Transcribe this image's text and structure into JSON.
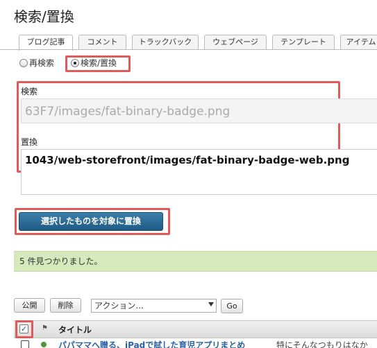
{
  "page": {
    "title": "検索/置換"
  },
  "tabs": [
    {
      "label": "ブログ記事",
      "active": true
    },
    {
      "label": "コメント",
      "active": false
    },
    {
      "label": "トラックバック",
      "active": false
    },
    {
      "label": "ウェブページ",
      "active": false
    },
    {
      "label": "テンプレート",
      "active": false
    },
    {
      "label": "アイテム",
      "active": false
    }
  ],
  "mode": {
    "research_label": "再検索",
    "replace_label": "検索/置換",
    "selected": "replace"
  },
  "search": {
    "label": "検索",
    "value": "63F7/images/fat-binary-badge.png"
  },
  "replace": {
    "label": "置換",
    "value": "1043/web-storefront/images/fat-binary-badge-web.png"
  },
  "actions": {
    "replace_selected_label": "選択したものを対象に置換",
    "publish_label": "公開",
    "delete_label": "削除",
    "action_select_value": "アクション...",
    "go_label": "Go"
  },
  "message": "5 件見つかりました。",
  "table": {
    "flag_header": "⚑",
    "title_header": "タイトル",
    "rows": [
      {
        "title": "パパママへ贈る、iPadで試した育児アプリまとめ",
        "excerpt": "特にそんなつもりはなか"
      }
    ]
  },
  "colors": {
    "highlight": "#e05a5a",
    "primary_button": "#1e5b86",
    "message_bg": "#d6e9bc",
    "link": "#2a62a8"
  }
}
